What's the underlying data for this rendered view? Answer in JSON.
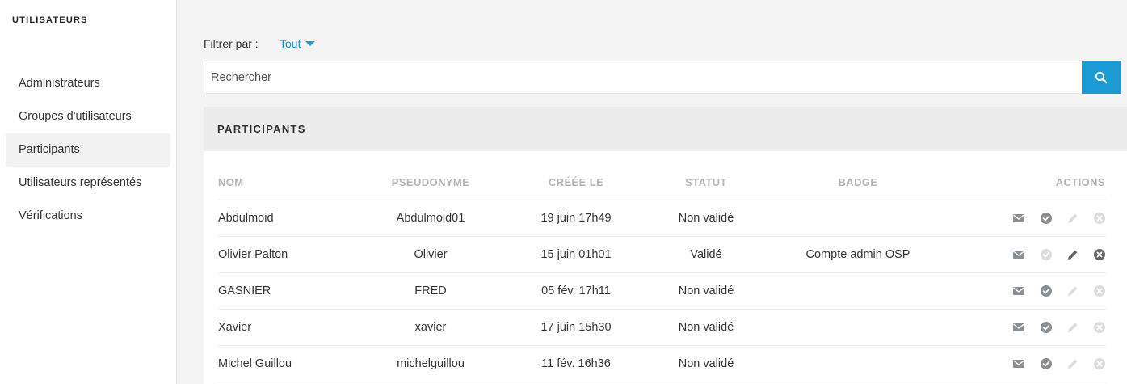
{
  "sidebar": {
    "title": "UTILISATEURS",
    "items": [
      {
        "label": "Administrateurs",
        "active": false
      },
      {
        "label": "Groupes d'utilisateurs",
        "active": false
      },
      {
        "label": "Participants",
        "active": true
      },
      {
        "label": "Utilisateurs représentés",
        "active": false
      },
      {
        "label": "Vérifications",
        "active": false
      }
    ]
  },
  "filter": {
    "label": "Filtrer par :",
    "value": "Tout"
  },
  "search": {
    "placeholder": "Rechercher",
    "icon": "search-icon"
  },
  "panel": {
    "title": "PARTICIPANTS",
    "columns": [
      "NOM",
      "PSEUDONYME",
      "CRÉÉE LE",
      "STATUT",
      "BADGE",
      "ACTIONS"
    ],
    "rows": [
      {
        "nom": "Abdulmoid",
        "pseudo": "Abdulmoid01",
        "date": "19 juin 17h49",
        "statut": "Non validé",
        "badge": "",
        "validated": false
      },
      {
        "nom": "Olivier Palton",
        "pseudo": "Olivier",
        "date": "15 juin 01h01",
        "statut": "Validé",
        "badge": "Compte admin OSP",
        "validated": true
      },
      {
        "nom": "GASNIER",
        "pseudo": "FRED",
        "date": "05 fév. 17h11",
        "statut": "Non validé",
        "badge": "",
        "validated": false
      },
      {
        "nom": "Xavier",
        "pseudo": "xavier",
        "date": "17 juin 15h30",
        "statut": "Non validé",
        "badge": "",
        "validated": false
      },
      {
        "nom": "Michel Guillou",
        "pseudo": "michelguillou",
        "date": "11 fév. 16h36",
        "statut": "Non validé",
        "badge": "",
        "validated": false
      }
    ],
    "action_icons": [
      "envelope-icon",
      "check-circle-icon",
      "pencil-icon",
      "close-circle-icon"
    ]
  },
  "colors": {
    "accent": "#1b9ad6",
    "icon_active": "#8a8f94",
    "icon_disabled": "#dcdcdc"
  }
}
